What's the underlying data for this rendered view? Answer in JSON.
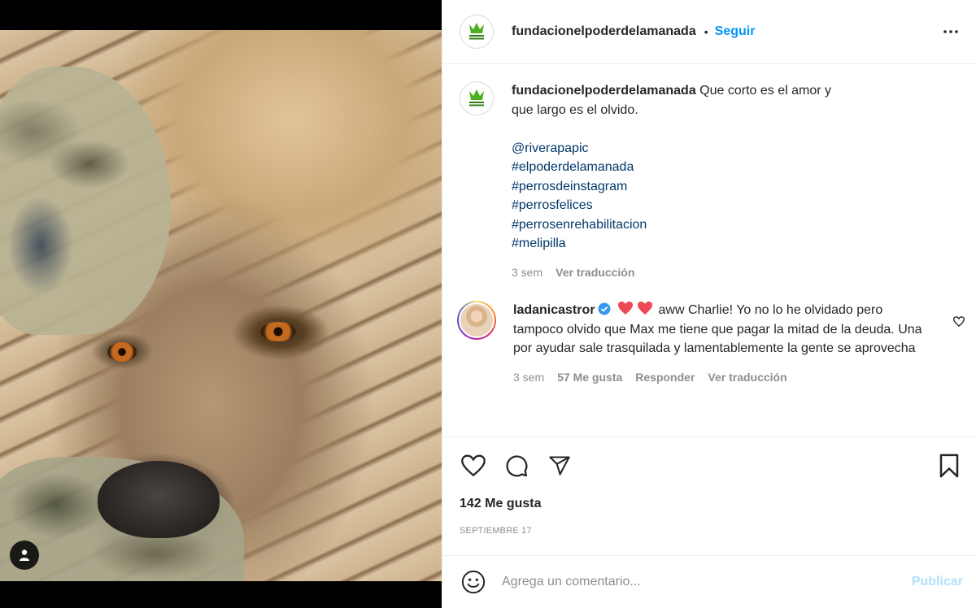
{
  "media": {
    "icons": {
      "user_tags": "person-icon"
    }
  },
  "header": {
    "username": "fundacionelpoderdelamanada",
    "separator": "•",
    "follow_label": "Seguir",
    "more_icon": "more-horizontal-icon"
  },
  "caption": {
    "username": "fundacionelpoderdelamanada",
    "text": "Que corto es el amor y que largo es el olvido.",
    "tags": [
      "@riverapapic",
      "#elpoderdelamanada",
      "#perrosdeinstagram",
      "#perrosfelices",
      "#perrosenrehabilitacion",
      "#melipilla"
    ],
    "time": "3 sem",
    "translate": "Ver traducción"
  },
  "comment": {
    "username": "ladanicastror",
    "text": "aww Charlie! Yo no lo he olvidado pero tampoco olvido que Max me tiene que pagar la mitad de la deuda. Una por ayudar sale trasquilada y lamentablemente la gente se aprovecha",
    "time": "3 sem",
    "likes": "57 Me gusta",
    "reply": "Responder",
    "translate": "Ver traducción"
  },
  "actions": {
    "icons": [
      "heart-icon",
      "comment-icon",
      "share-icon",
      "bookmark-icon"
    ],
    "likes_count": "142 Me gusta",
    "date": "septiembre 17"
  },
  "add_comment": {
    "placeholder": "Agrega un comentario...",
    "publish_label": "Publicar"
  },
  "colors": {
    "accent": "#0095f6",
    "link": "#00376b",
    "muted": "#8e8e8e",
    "heart": "#ed4956",
    "publish_disabled": "#b2dffc"
  }
}
